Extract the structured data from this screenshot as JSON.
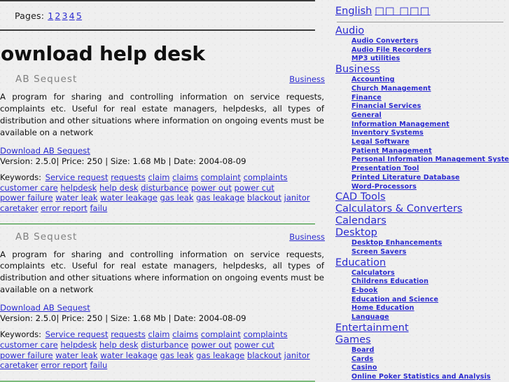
{
  "pagination": {
    "label": "Pages:",
    "pages": [
      "1",
      "2",
      "3",
      "4",
      "5"
    ]
  },
  "page_title": "Download help desk",
  "listings": [
    {
      "title": "AB Sequest",
      "category": "Business",
      "description": "A program for sharing and controlling information on service requests, complaints etc. Useful for real estate managers, helpdesks, all types of distribution and other situations where information on ongoing events must be available on a network",
      "download_label": "Download AB Sequest",
      "meta": "Version: 2.5.0| Price: 250 | Size: 1.68 Mb | Date: 2004-08-09",
      "keywords_label": "Keywords:",
      "keywords": [
        "Service request",
        "requests",
        "claim",
        "claims",
        "complaint",
        "complaints",
        "customer care",
        "helpdesk",
        "help desk",
        "disturbance",
        "power out",
        "power cut",
        "power failure",
        "water leak",
        "water leakage",
        "gas leak",
        "gas leakage",
        "blackout",
        "janitor",
        "caretaker",
        "error report",
        "failu"
      ]
    },
    {
      "title": "AB Sequest",
      "category": "Business",
      "description": "A program for sharing and controlling information on service requests, complaints etc. Useful for real estate managers, helpdesks, all types of distribution and other situations where information on ongoing events must be available on a network",
      "download_label": "Download AB Sequest",
      "meta": "Version: 2.5.0| Price: 250 | Size: 1.68 Mb | Date: 2004-08-09",
      "keywords_label": "Keywords:",
      "keywords": [
        "Service request",
        "requests",
        "claim",
        "claims",
        "complaint",
        "complaints",
        "customer care",
        "helpdesk",
        "help desk",
        "disturbance",
        "power out",
        "power cut",
        "power failure",
        "water leak",
        "water leakage",
        "gas leak",
        "gas leakage",
        "blackout",
        "janitor",
        "caretaker",
        "error report",
        "failu"
      ]
    }
  ],
  "sidebar": {
    "language_label": "English",
    "language_alt": "□□ □□□",
    "categories": [
      {
        "label": "Audio",
        "items": [
          "Audio Converters",
          "Audio File Recorders",
          "MP3 utilities"
        ]
      },
      {
        "label": "Business",
        "items": [
          "Accounting",
          "Church Management",
          "Finance",
          "Financial Services",
          "General",
          "Information Management",
          "Inventory Systems",
          "Legal Software",
          "Patient Management",
          "Personal Information Management System",
          "Presentation Tool",
          "Printed Literature Database",
          "Word-Processors"
        ]
      },
      {
        "label": "CAD Tools",
        "items": []
      },
      {
        "label": "Calculators & Converters",
        "items": []
      },
      {
        "label": "Calendars",
        "items": []
      },
      {
        "label": "Desktop",
        "items": [
          "Desktop Enhancements",
          "Screen Savers"
        ]
      },
      {
        "label": "Education",
        "items": [
          "Calculators",
          "Childrens Education",
          "E-book",
          "Education and Science",
          "Home Education",
          "Language"
        ]
      },
      {
        "label": "Entertainment",
        "items": []
      },
      {
        "label": "Games",
        "items": [
          "Board",
          "Cards",
          "Casino",
          "Online Poker Statistics and Analysis"
        ]
      }
    ]
  },
  "colors": {
    "link": "#2b2bd0",
    "background": "#efefef",
    "title_gray": "#808080",
    "rule_dark": "#3c3c3c",
    "rule_green_dark": "#1f8a1f",
    "rule_green_light": "#7cbb7c"
  }
}
